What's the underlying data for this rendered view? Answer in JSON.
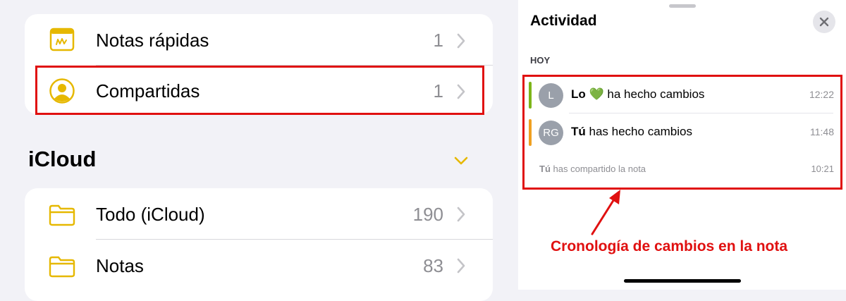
{
  "folders_top": [
    {
      "label": "Notas rápidas",
      "count": "1",
      "icon": "quick-note-icon"
    },
    {
      "label": "Compartidas",
      "count": "1",
      "icon": "shared-person-icon"
    }
  ],
  "icloud": {
    "title": "iCloud",
    "folders": [
      {
        "label": "Todo (iCloud)",
        "count": "190",
        "icon": "folder-icon"
      },
      {
        "label": "Notas",
        "count": "83",
        "icon": "folder-icon"
      }
    ]
  },
  "activity": {
    "title": "Actividad",
    "section": "HOY",
    "items": [
      {
        "initials": "L",
        "name": "Lo",
        "emoji": "💚",
        "text": "ha hecho cambios",
        "time": "12:22",
        "bar_color": "#7cb518"
      },
      {
        "initials": "RG",
        "name": "Tú",
        "text": "has hecho cambios",
        "time": "11:48",
        "bar_color": "#f0a020"
      }
    ],
    "shared": {
      "name": "Tú",
      "text": "has compartido la nota",
      "time": "10:21"
    }
  },
  "annotation": "Cronología de cambios en la nota",
  "colors": {
    "accent": "#e6b800",
    "highlight": "#e01010"
  }
}
